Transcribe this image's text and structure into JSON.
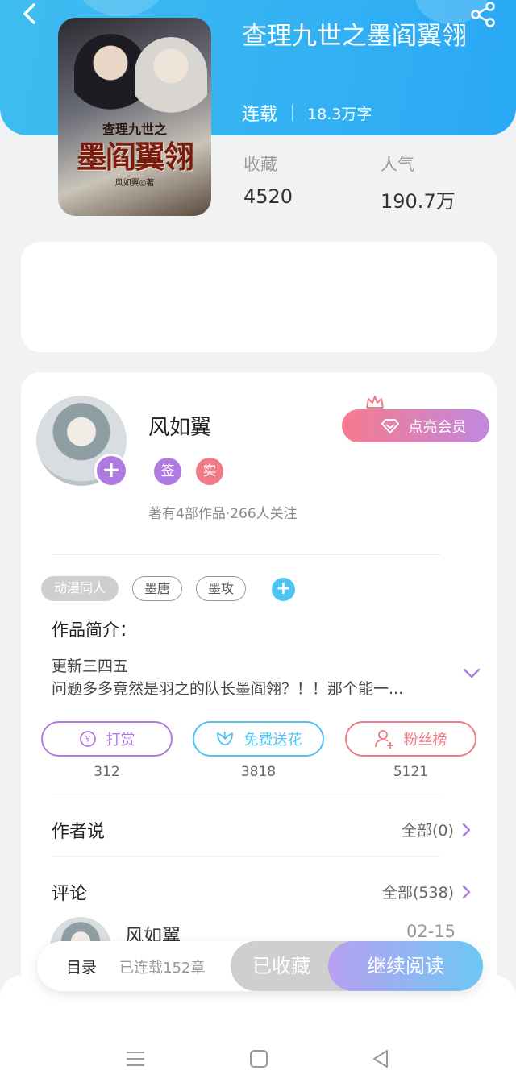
{
  "header": {
    "title": "查理九世之墨阎翼翎",
    "status": "连载",
    "word_count": "18.3万字",
    "cover_text": {
      "line1": "查理九世之",
      "line2": "墨阎翼翎",
      "line3": "风如翼◎著"
    }
  },
  "stats": [
    {
      "label": "收藏",
      "value": "4520"
    },
    {
      "label": "人气",
      "value": "190.7万"
    }
  ],
  "author": {
    "name": "风如翼",
    "badges": [
      {
        "text": "签",
        "color": "#b07be0"
      },
      {
        "text": "实",
        "color": "#f07a86"
      }
    ],
    "subtitle": "著有4部作品·266人关注",
    "vip_button": "点亮会员"
  },
  "tags": [
    "动漫同人",
    "墨唐",
    "墨攻"
  ],
  "intro": {
    "title": "作品简介：",
    "line1": "更新三四五",
    "line2": "问题多多竟然是羽之的队长墨阎翎？！！那个能一..."
  },
  "actions": [
    {
      "label": "打赏",
      "count": "312",
      "color": "#b07be0"
    },
    {
      "label": "免费送花",
      "count": "3818",
      "color": "#4fc4f3"
    },
    {
      "label": "粉丝榜",
      "count": "5121",
      "color": "#f07a86"
    }
  ],
  "author_says": {
    "title": "作者说",
    "more": "全部(0)"
  },
  "comments": {
    "title": "评论",
    "more": "全部(538)",
    "first": {
      "name": "风如翼",
      "date": "02-15"
    }
  },
  "bottom_bar": {
    "toc": "目录",
    "chapters": "已连载152章",
    "collected": "已收藏",
    "continue": "继续阅读"
  }
}
